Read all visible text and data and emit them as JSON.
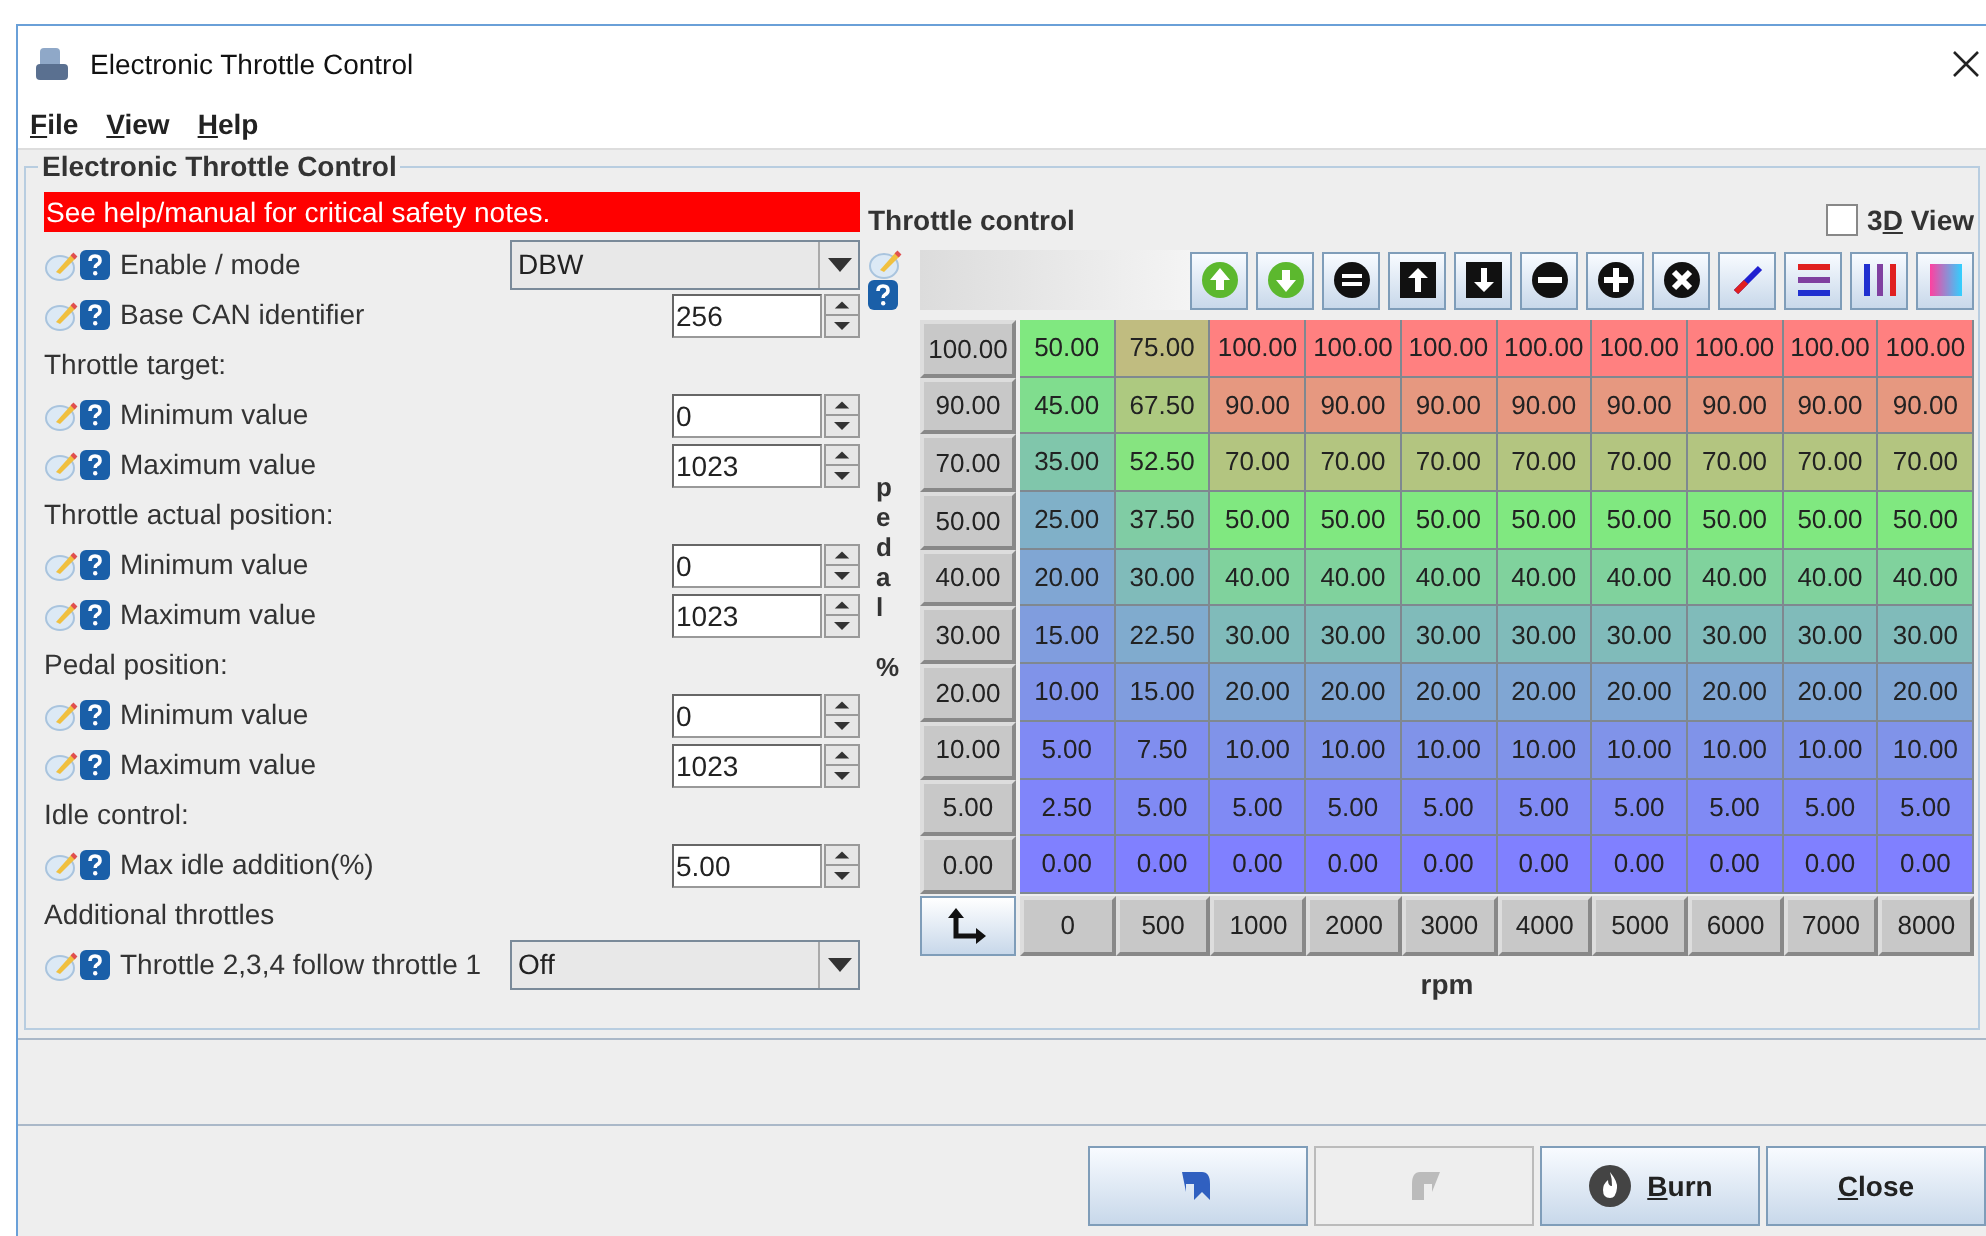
{
  "window": {
    "title": "Electronic Throttle Control"
  },
  "menu": [
    {
      "label": "File"
    },
    {
      "label": "View"
    },
    {
      "label": "Help"
    }
  ],
  "group": {
    "title": "Electronic Throttle Control",
    "warning": "See help/manual for critical safety notes."
  },
  "settings": [
    {
      "kind": "combo",
      "label": "Enable / mode",
      "value": "DBW"
    },
    {
      "kind": "spinner",
      "label": "Base CAN identifier",
      "value": "256"
    },
    {
      "kind": "header",
      "label": "Throttle target:"
    },
    {
      "kind": "spinner",
      "label": "Minimum value",
      "value": "0"
    },
    {
      "kind": "spinner",
      "label": "Maximum value",
      "value": "1023"
    },
    {
      "kind": "header",
      "label": "Throttle actual position:"
    },
    {
      "kind": "spinner",
      "label": "Minimum value",
      "value": "0"
    },
    {
      "kind": "spinner",
      "label": "Maximum value",
      "value": "1023"
    },
    {
      "kind": "header",
      "label": "Pedal position:"
    },
    {
      "kind": "spinner",
      "label": "Minimum value",
      "value": "0"
    },
    {
      "kind": "spinner",
      "label": "Maximum value",
      "value": "1023"
    },
    {
      "kind": "header",
      "label": "Idle control:"
    },
    {
      "kind": "spinner",
      "label": "Max idle addition(%)",
      "value": "5.00"
    },
    {
      "kind": "header",
      "label": "Additional throttles"
    },
    {
      "kind": "widecombo",
      "label": "Throttle 2,3,4 follow throttle 1",
      "value": "Off"
    }
  ],
  "table": {
    "title": "Throttle control",
    "view_3d": {
      "label": "3D View",
      "checked": false
    },
    "y_label": "pedal %",
    "x_label": "rpm",
    "y_axis": [
      "100.00",
      "90.00",
      "70.00",
      "50.00",
      "40.00",
      "30.00",
      "20.00",
      "10.00",
      "5.00",
      "0.00"
    ],
    "x_axis": [
      "0",
      "500",
      "1000",
      "2000",
      "3000",
      "4000",
      "5000",
      "6000",
      "7000",
      "8000"
    ],
    "rows": [
      [
        "50.00",
        "75.00",
        "100.00",
        "100.00",
        "100.00",
        "100.00",
        "100.00",
        "100.00",
        "100.00",
        "100.00"
      ],
      [
        "45.00",
        "67.50",
        "90.00",
        "90.00",
        "90.00",
        "90.00",
        "90.00",
        "90.00",
        "90.00",
        "90.00"
      ],
      [
        "35.00",
        "52.50",
        "70.00",
        "70.00",
        "70.00",
        "70.00",
        "70.00",
        "70.00",
        "70.00",
        "70.00"
      ],
      [
        "25.00",
        "37.50",
        "50.00",
        "50.00",
        "50.00",
        "50.00",
        "50.00",
        "50.00",
        "50.00",
        "50.00"
      ],
      [
        "20.00",
        "30.00",
        "40.00",
        "40.00",
        "40.00",
        "40.00",
        "40.00",
        "40.00",
        "40.00",
        "40.00"
      ],
      [
        "15.00",
        "22.50",
        "30.00",
        "30.00",
        "30.00",
        "30.00",
        "30.00",
        "30.00",
        "30.00",
        "30.00"
      ],
      [
        "10.00",
        "15.00",
        "20.00",
        "20.00",
        "20.00",
        "20.00",
        "20.00",
        "20.00",
        "20.00",
        "20.00"
      ],
      [
        "5.00",
        "7.50",
        "10.00",
        "10.00",
        "10.00",
        "10.00",
        "10.00",
        "10.00",
        "10.00",
        "10.00"
      ],
      [
        "2.50",
        "5.00",
        "5.00",
        "5.00",
        "5.00",
        "5.00",
        "5.00",
        "5.00",
        "5.00",
        "5.00"
      ],
      [
        "0.00",
        "0.00",
        "0.00",
        "0.00",
        "0.00",
        "0.00",
        "0.00",
        "0.00",
        "0.00",
        "0.00"
      ]
    ]
  },
  "buttons": [
    {
      "kind": "undo",
      "disabled": false
    },
    {
      "kind": "redo",
      "disabled": true
    },
    {
      "kind": "burn",
      "label": "Burn"
    },
    {
      "kind": "close",
      "label": "Close"
    }
  ]
}
